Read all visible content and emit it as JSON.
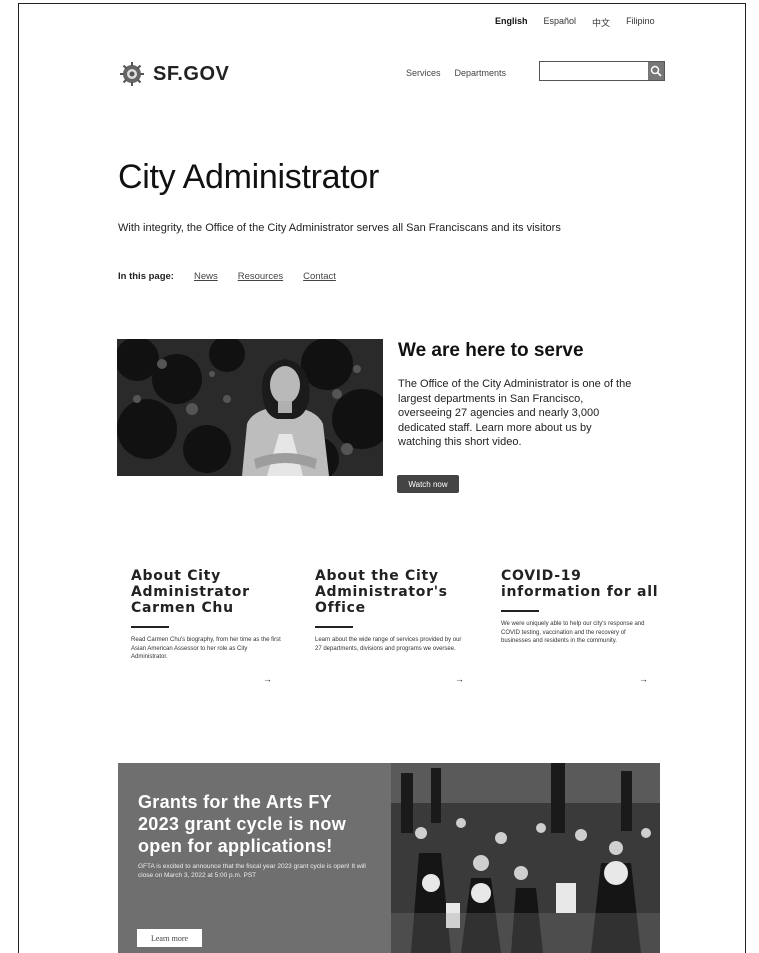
{
  "top_bar": {
    "languages": [
      "English",
      "Español",
      "中文",
      "Filipino"
    ]
  },
  "header": {
    "logo_text": "SF.GOV",
    "nav": [
      "Services",
      "Departments"
    ],
    "search_placeholder": ""
  },
  "page": {
    "title": "City Administrator",
    "lede": "With integrity, the Office of the City Administrator serves all San Franciscans and its visitors",
    "in_this_page_label": "In this page:",
    "in_this_page_links": [
      "News",
      "Resources",
      "Contact"
    ]
  },
  "hero": {
    "heading": "We are here to serve",
    "body": "The Office of the City Administrator is one of the largest departments in San Francisco, overseeing 27 agencies and nearly 3,000 dedicated staff. Learn more about us by watching this short video.",
    "button": "Watch now"
  },
  "cards": [
    {
      "title_lines": [
        "About City",
        "Administrator",
        "Carmen Chu"
      ],
      "body": "Read Carmen Chu's biography, from her time as the first Asian American Assessor to her role as City Administrator."
    },
    {
      "title_lines": [
        "About the City",
        "Administrator's",
        "Office"
      ],
      "body": "Learn about the wide range of services provided by our 27 departments, divisions and programs we oversee."
    },
    {
      "title_lines": [
        "COVID-19",
        "information for all"
      ],
      "body": "We were uniquely able to help our city's response and COVID testing, vaccination and the recovery of businesses and residents in the community."
    }
  ],
  "banner": {
    "title": "Grants for the Arts FY 2023 grant cycle is now open for applications!",
    "body": "GFTA is excited to announce that the fiscal year 2023 grant cycle is open! It will close on March 3, 2022 at 5:00 p.m. PST",
    "button": "Learn more"
  },
  "colors": {
    "banner_gray": "#6f6f6f",
    "button_dark": "#444444"
  }
}
